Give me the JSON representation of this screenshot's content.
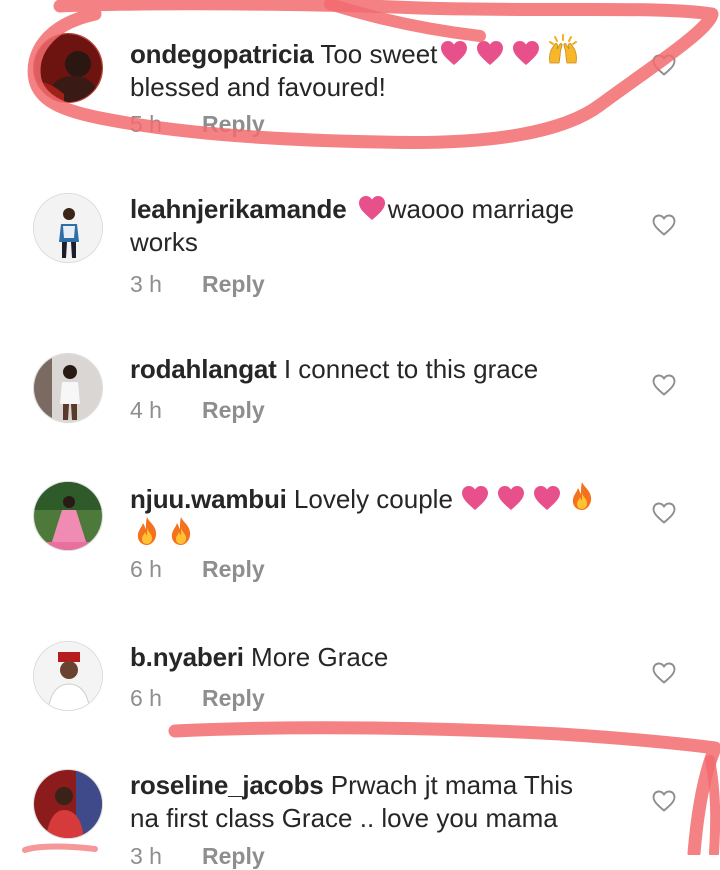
{
  "colors": {
    "text": "#262626",
    "meta": "#8e8e8e",
    "heart_emoji": "#e8508c",
    "annotation": "#f26b6e"
  },
  "comments": [
    {
      "username": "ondegopatricia",
      "text": "Too sweet",
      "text_line2": "blessed and favoured!",
      "emojis": [
        "pink-heart",
        "pink-heart",
        "pink-heart",
        "raising-hands"
      ],
      "time": "5 h",
      "reply_label": "Reply"
    },
    {
      "username": "leahnjerikamande",
      "lead_emoji": "pink-heart",
      "text": "waooo marriage",
      "text_line2": "works",
      "time": "3 h",
      "reply_label": "Reply"
    },
    {
      "username": "rodahlangat",
      "text": "I connect to this grace",
      "time": "4 h",
      "reply_label": "Reply"
    },
    {
      "username": "njuu.wambui",
      "text": "Lovely couple",
      "emojis": [
        "pink-heart",
        "pink-heart",
        "pink-heart",
        "fire",
        "fire",
        "fire"
      ],
      "time": "6 h",
      "reply_label": "Reply"
    },
    {
      "username": "b.nyaberi",
      "text": "More Grace",
      "time": "6 h",
      "reply_label": "Reply"
    },
    {
      "username": "roseline_jacobs",
      "text": "Prwach jt mama This",
      "text_line2": "na first class Grace .. love you mama",
      "time": "3 h",
      "reply_label": "Reply"
    }
  ],
  "icons": {
    "like": "heart-outline-icon"
  }
}
